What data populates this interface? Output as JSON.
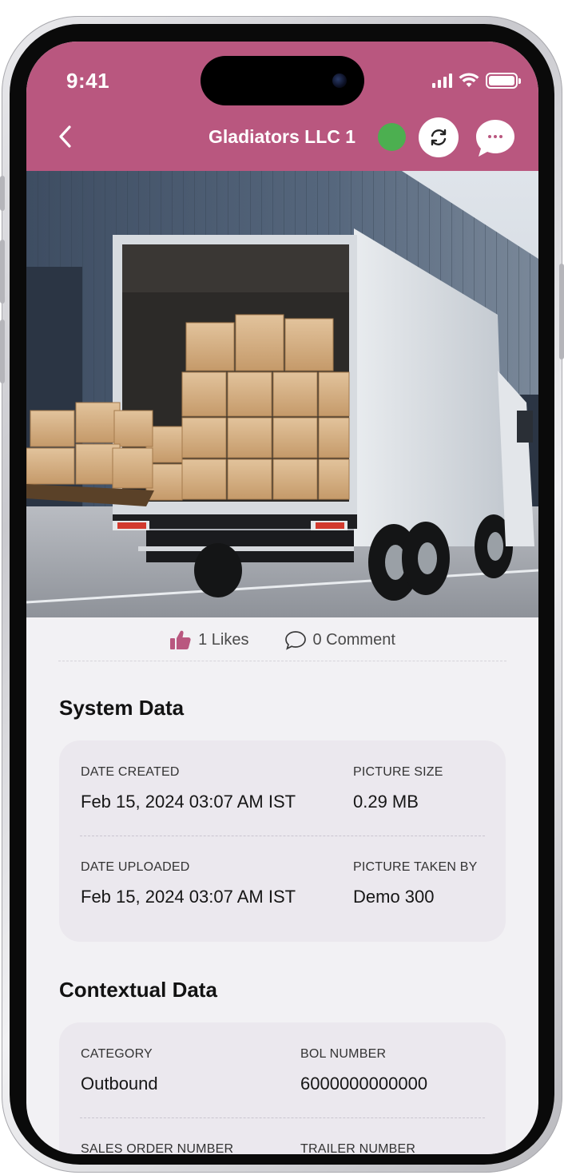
{
  "status_bar": {
    "time": "9:41"
  },
  "nav": {
    "title": "Gladiators LLC 1",
    "online_color": "#4caf50",
    "back_icon": "chevron-left-icon",
    "sync_icon": "sync-icon",
    "chat_icon": "chat-bubble-icon"
  },
  "theme": {
    "accent": "#b9577f",
    "like_color": "#b9577f"
  },
  "photo": {
    "subject": "box-truck-with-cardboard-boxes"
  },
  "reactions": {
    "likes": "1 Likes",
    "comments": "0 Comment"
  },
  "system_data": {
    "title": "System Data",
    "date_created_label": "DATE CREATED",
    "date_created": "Feb 15, 2024 03:07 AM IST",
    "picture_size_label": "PICTURE SIZE",
    "picture_size": "0.29 MB",
    "date_uploaded_label": "DATE UPLOADED",
    "date_uploaded": "Feb 15, 2024 03:07 AM IST",
    "taken_by_label": "PICTURE TAKEN BY",
    "taken_by": "Demo 300"
  },
  "contextual_data": {
    "title": "Contextual Data",
    "category_label": "CATEGORY",
    "category": "Outbound",
    "bol_label": "BOL NUMBER",
    "bol": "6000000000000",
    "sales_order_label": "SALES ORDER NUMBER",
    "trailer_label": "TRAILER NUMBER"
  }
}
